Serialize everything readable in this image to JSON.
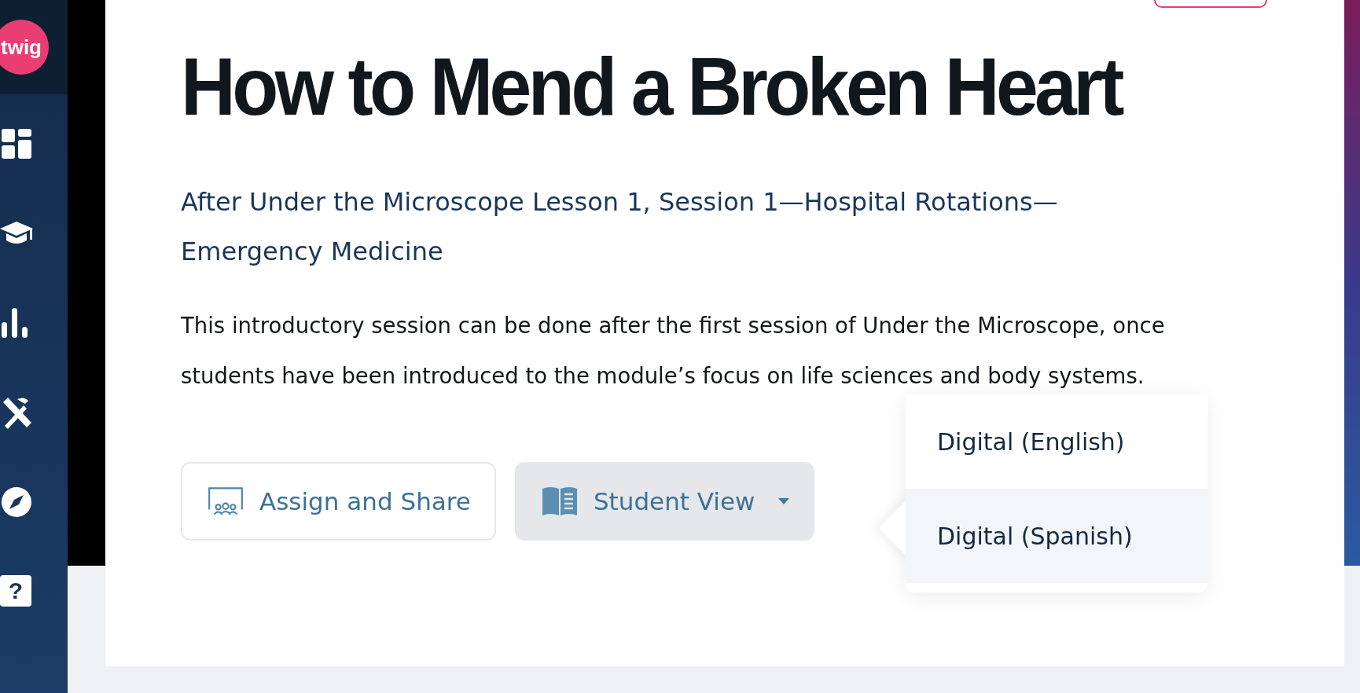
{
  "sidebar": {
    "logo": "twig",
    "items": [
      {
        "kind": "dashboard",
        "selected": false
      },
      {
        "kind": "graduation",
        "selected": false
      },
      {
        "kind": "chart",
        "selected": false
      },
      {
        "kind": "tools",
        "selected": false
      },
      {
        "kind": "compass",
        "selected": false
      },
      {
        "kind": "help",
        "label": "?",
        "selected": false
      }
    ]
  },
  "lesson": {
    "title": "How to Mend a Broken Heart",
    "subtitle": "After Under the Microscope Lesson 1, Session 1—Hospital Rotations—Emergency Medicine",
    "description": "This introductory session can be done after the first session of Under the Microscope, once students have been introduced to the module’s focus on life sciences and body systems."
  },
  "buttons": [
    {
      "kind": "assign",
      "label": "Assign and Share"
    },
    {
      "kind": "view",
      "label": "Student View",
      "expanded": true
    }
  ],
  "menu": {
    "items": [
      {
        "label": "Digital (English)",
        "selected": false
      },
      {
        "label": "Digital (Spanish)",
        "selected": true
      }
    ]
  }
}
